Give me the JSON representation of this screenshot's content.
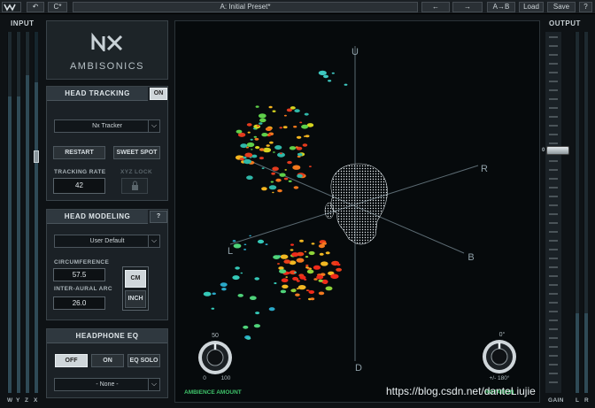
{
  "toolbar": {
    "undo_label": "↶",
    "redo_label": "C*",
    "preset_name": "A: Initial Preset*",
    "prev_label": "←",
    "next_label": "→",
    "ab_label": "A→B",
    "load_label": "Load",
    "save_label": "Save",
    "help_label": "?"
  },
  "input": {
    "label": "INPUT",
    "channels": [
      "W",
      "Y",
      "Z",
      "X"
    ],
    "levels": [
      0.82,
      0.82,
      0.88,
      0.86
    ]
  },
  "output": {
    "label": "OUTPUT",
    "gain_label": "GAIN",
    "channels": [
      "L",
      "R"
    ],
    "zero_label": "0",
    "levels": [
      0.22,
      0.22
    ]
  },
  "logo": {
    "mark": "nx",
    "name": "AMBISONICS"
  },
  "head_tracking": {
    "title": "HEAD TRACKING",
    "toggle": "ON",
    "tracker": "Nx Tracker",
    "restart": "RESTART",
    "sweet_spot": "SWEET SPOT",
    "rate_label": "TRACKING RATE",
    "rate_value": "42",
    "xyz_lock": "XYZ LOCK"
  },
  "head_modeling": {
    "title": "HEAD MODELING",
    "help": "?",
    "preset": "User Default",
    "circ_label": "CIRCUMFERENCE",
    "circ_value": "57.5",
    "interaural_label": "INTER-AURAL ARC",
    "interaural_value": "26.0",
    "unit_cm": "CM",
    "unit_inch": "INCH"
  },
  "headphone_eq": {
    "title": "HEADPHONE EQ",
    "off": "OFF",
    "on": "ON",
    "eq_solo": "EQ SOLO",
    "preset": "- None -"
  },
  "view": {
    "axis_u": "U",
    "axis_d": "D",
    "axis_r": "R",
    "axis_l": "L",
    "axis_b": "B",
    "ambience_value": "50",
    "ambience_min": "0",
    "ambience_max": "100",
    "ambience_label": "AMBIENCE AMOUNT",
    "rotation_value": "0°",
    "rotation_range": "+/- 180°",
    "rotation_label": "ROTATION"
  },
  "watermark": "https://blog.csdn.net/danteLiujie"
}
